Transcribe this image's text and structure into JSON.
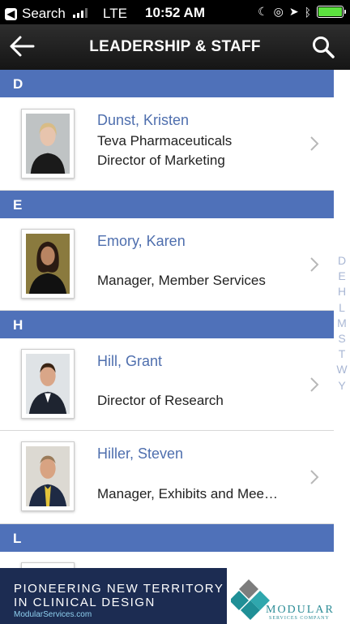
{
  "status_bar": {
    "back_app": "Search",
    "network": "LTE",
    "time": "10:52 AM"
  },
  "nav": {
    "title": "LEADERSHIP & STAFF"
  },
  "sections": [
    {
      "letter": "D",
      "people": [
        {
          "name": "Dunst, Kristen",
          "company": "Teva Pharmaceuticals",
          "title": "Director of Marketing"
        }
      ]
    },
    {
      "letter": "E",
      "people": [
        {
          "name": "Emory, Karen",
          "company": "",
          "title": "Manager, Member Services"
        }
      ]
    },
    {
      "letter": "H",
      "people": [
        {
          "name": "Hill, Grant",
          "company": "",
          "title": "Director of Research"
        },
        {
          "name": "Hiller, Steven",
          "company": "",
          "title": "Manager, Exhibits and Mee…"
        }
      ]
    },
    {
      "letter": "L",
      "people": []
    }
  ],
  "index": [
    "D",
    "E",
    "H",
    "L",
    "M",
    "S",
    "T",
    "W",
    "Y"
  ],
  "ad": {
    "headline_line1": "PIONEERING NEW TERRITORY",
    "headline_line2": "IN CLINICAL DESIGN",
    "url": "ModularServices.com",
    "brand": "MODULAR",
    "tagline": "SERVICES COMPANY"
  },
  "colors": {
    "section_header": "#4f71b9",
    "name_link": "#4f6fae",
    "index_letters": "#a9b7d4",
    "ad_background": "#1c2c52",
    "brand_teal": "#2c8c96"
  }
}
